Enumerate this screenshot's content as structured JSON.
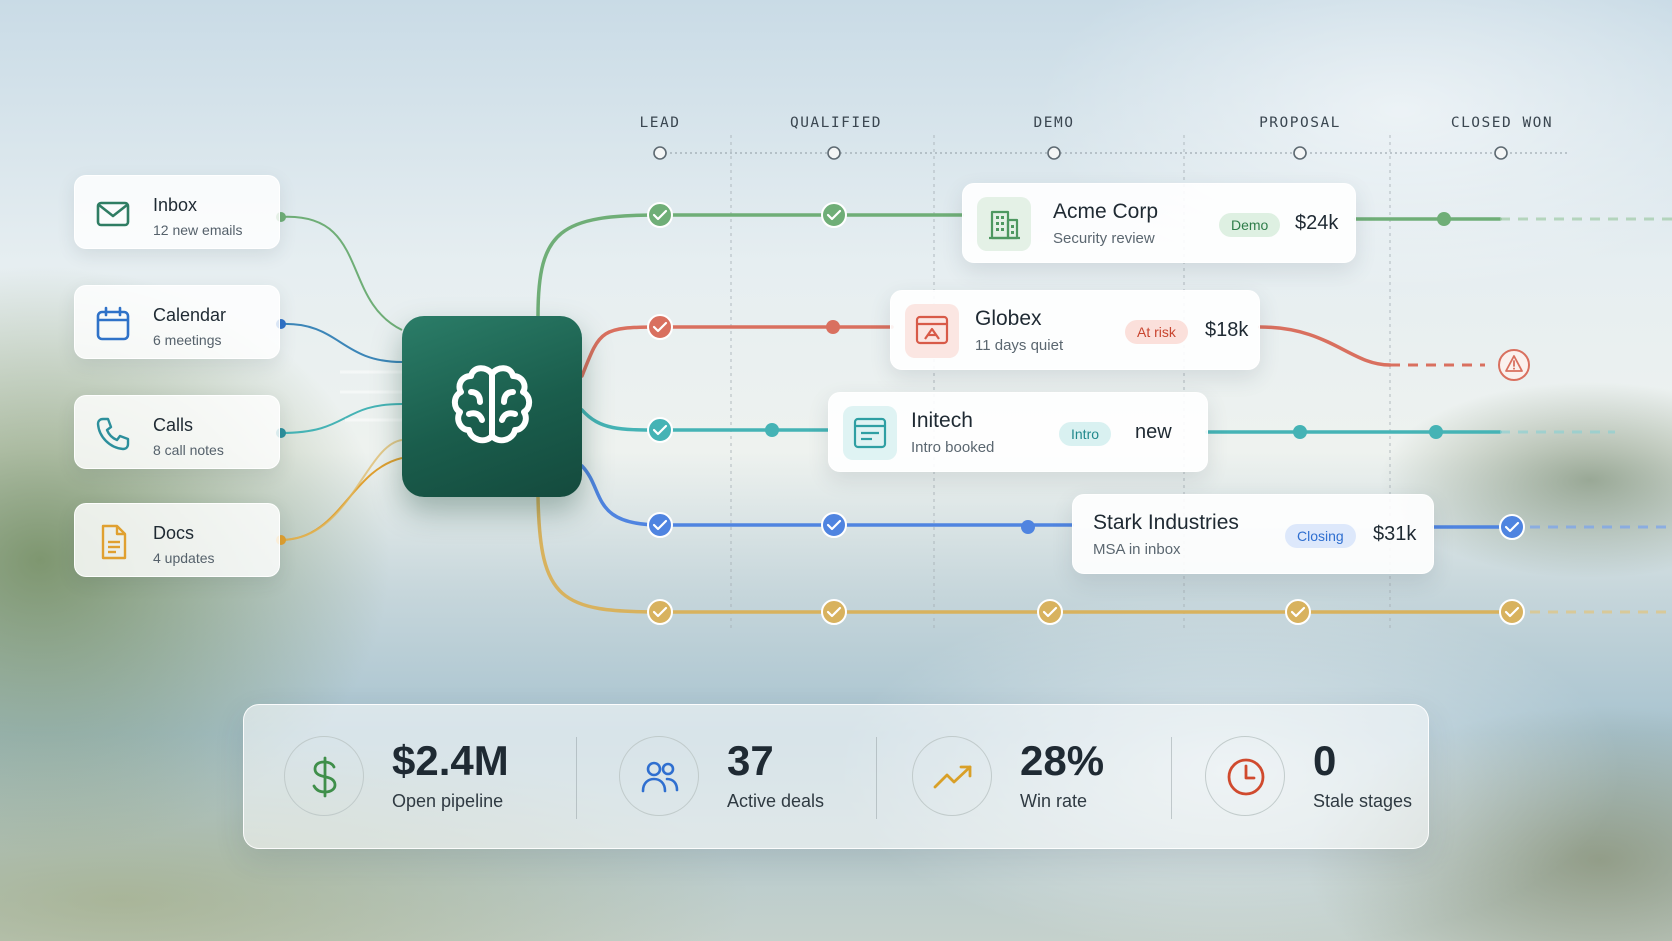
{
  "pipeline": {
    "stages": [
      "LEAD",
      "QUALIFIED",
      "DEMO",
      "PROPOSAL",
      "CLOSED WON"
    ]
  },
  "sources": [
    {
      "title": "Inbox",
      "subtitle": "12 new emails",
      "icon": "mail-icon",
      "color": "#2f7d63"
    },
    {
      "title": "Calendar",
      "subtitle": "6 meetings",
      "icon": "calendar-icon",
      "color": "#2f72c8"
    },
    {
      "title": "Calls",
      "subtitle": "8 call notes",
      "icon": "phone-icon",
      "color": "#2c8f9c"
    },
    {
      "title": "Docs",
      "subtitle": "4 updates",
      "icon": "document-icon",
      "color": "#e0a030"
    }
  ],
  "hub": {
    "icon": "brain-icon"
  },
  "deals": [
    {
      "name": "Acme Corp",
      "note": "Security review",
      "badge": "Demo",
      "amount": "$24k",
      "icon": "building-icon",
      "color": "#5fa56b"
    },
    {
      "name": "Globex",
      "note": "11 days quiet",
      "badge": "At risk",
      "amount": "$18k",
      "icon": "presentation-icon",
      "color": "#db6a5a"
    },
    {
      "name": "Initech",
      "note": "Intro booked",
      "badge": "Intro",
      "amount": "new",
      "icon": "window-icon",
      "color": "#3bb0b4"
    },
    {
      "name": "Stark Industries",
      "note": "MSA in inbox",
      "badge": "Closing",
      "amount": "$31k",
      "icon": "",
      "color": "#4d7fdc"
    }
  ],
  "stats": [
    {
      "value": "$2.4M",
      "label": "Open pipeline",
      "icon": "dollar-icon",
      "color": "#3f8f4a"
    },
    {
      "value": "37",
      "label": "Active deals",
      "icon": "users-icon",
      "color": "#2f6fd0"
    },
    {
      "value": "28%",
      "label": "Win rate",
      "icon": "trending-up-icon",
      "color": "#d9a028"
    },
    {
      "value": "0",
      "label": "Stale stages",
      "icon": "clock-icon",
      "color": "#d04a2e"
    }
  ],
  "colors": {
    "hub": "#1f6b58",
    "green": "#6fae77",
    "red": "#d9705f",
    "teal": "#45b3b5",
    "blue": "#4f84e0",
    "gold": "#d8b25e"
  }
}
